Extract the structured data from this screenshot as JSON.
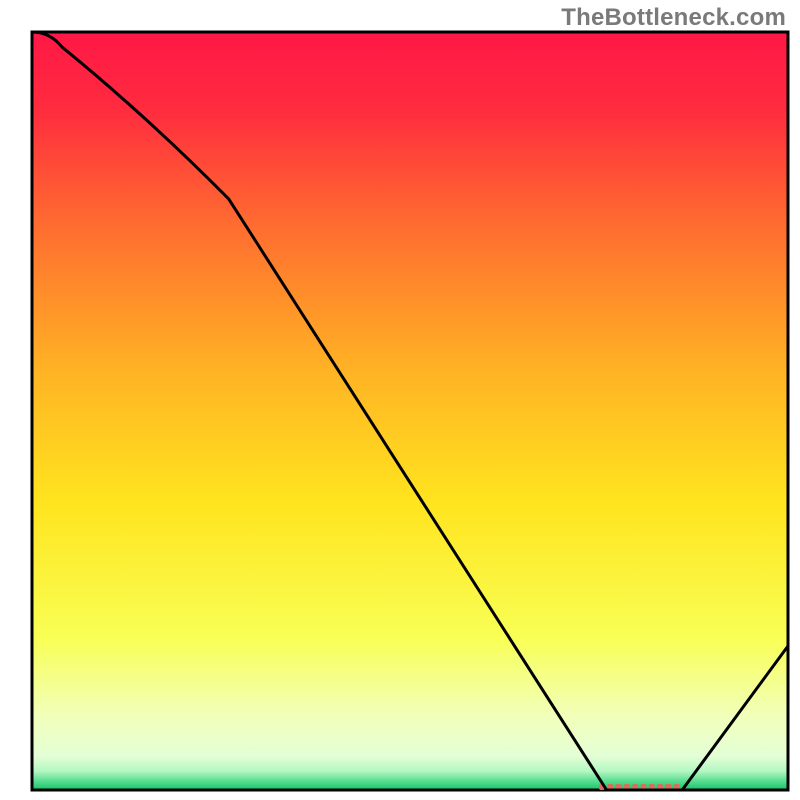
{
  "watermark": "TheBottleneck.com",
  "chart_data": {
    "type": "line",
    "title": "",
    "xlabel": "",
    "ylabel": "",
    "xlim": [
      0,
      100
    ],
    "ylim": [
      0,
      100
    ],
    "x": [
      0,
      4,
      26,
      76,
      86,
      100
    ],
    "values": [
      100,
      98,
      78,
      0,
      0,
      19
    ],
    "marker": {
      "x_start": 75,
      "x_end": 86,
      "y": 0,
      "color": "#e06a5a"
    },
    "gradient_stops": [
      {
        "offset": 0,
        "color": "#ff1846"
      },
      {
        "offset": 0.1,
        "color": "#ff2b3f"
      },
      {
        "offset": 0.25,
        "color": "#ff6a30"
      },
      {
        "offset": 0.45,
        "color": "#ffb424"
      },
      {
        "offset": 0.62,
        "color": "#ffe41e"
      },
      {
        "offset": 0.8,
        "color": "#f8ff55"
      },
      {
        "offset": 0.9,
        "color": "#f2ffb8"
      },
      {
        "offset": 0.955,
        "color": "#e4ffd6"
      },
      {
        "offset": 0.975,
        "color": "#b4f7c2"
      },
      {
        "offset": 0.99,
        "color": "#4dd98a"
      },
      {
        "offset": 1.0,
        "color": "#17c36b"
      }
    ],
    "border_color": "#000000",
    "curve_color": "#000000"
  }
}
